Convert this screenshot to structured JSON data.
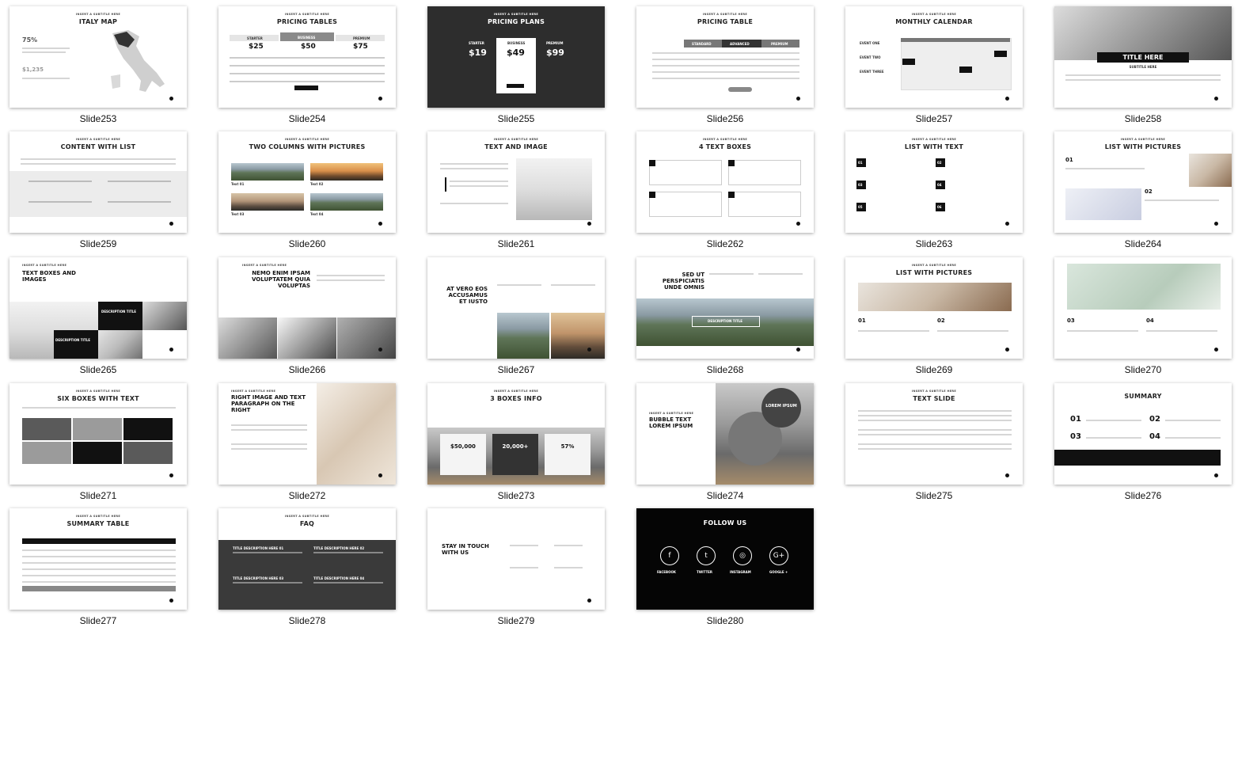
{
  "slides": [
    {
      "caption": "Slide253",
      "kicker": "INSERT A SUBTITLE HERE",
      "title": "ITALY MAP",
      "extra": [
        "75%",
        "$1,235"
      ]
    },
    {
      "caption": "Slide254",
      "kicker": "INSERT A SUBTITLE HERE",
      "title": "PRICING TABLES",
      "extra": [
        "STARTER",
        "BUSINESS",
        "PREMIUM",
        "$25",
        "$50",
        "$75"
      ]
    },
    {
      "caption": "Slide255",
      "kicker": "INSERT A SUBTITLE HERE",
      "title": "PRICING PLANS",
      "extra": [
        "STARTER",
        "BUSINESS",
        "PREMIUM",
        "$19",
        "$49",
        "$99"
      ]
    },
    {
      "caption": "Slide256",
      "kicker": "INSERT A SUBTITLE HERE",
      "title": "PRICING TABLE",
      "extra": [
        "STANDARD",
        "ADVANCED",
        "PREMIUM"
      ]
    },
    {
      "caption": "Slide257",
      "kicker": "INSERT A SUBTITLE HERE",
      "title": "MONTHLY CALENDAR",
      "extra": [
        "EVENT ONE",
        "EVENT TWO",
        "EVENT THREE"
      ]
    },
    {
      "caption": "Slide258",
      "kicker": "",
      "title": "TITLE HERE",
      "extra": [
        "SUBTITLE HERE"
      ]
    },
    {
      "caption": "Slide259",
      "kicker": "INSERT A SUBTITLE HERE",
      "title": "CONTENT WITH LIST",
      "extra": []
    },
    {
      "caption": "Slide260",
      "kicker": "INSERT A SUBTITLE HERE",
      "title": "TWO COLUMNS WITH PICTURES",
      "extra": [
        "Text 01",
        "Text 02",
        "Text 03",
        "Text 04"
      ]
    },
    {
      "caption": "Slide261",
      "kicker": "INSERT A SUBTITLE HERE",
      "title": "TEXT AND IMAGE",
      "extra": []
    },
    {
      "caption": "Slide262",
      "kicker": "INSERT A SUBTITLE HERE",
      "title": "4 TEXT BOXES",
      "extra": []
    },
    {
      "caption": "Slide263",
      "kicker": "INSERT A SUBTITLE HERE",
      "title": "LIST WITH TEXT",
      "extra": [
        "01",
        "02",
        "03",
        "04",
        "05",
        "06"
      ]
    },
    {
      "caption": "Slide264",
      "kicker": "INSERT A SUBTITLE HERE",
      "title": "LIST WITH PICTURES",
      "extra": [
        "01",
        "02"
      ]
    },
    {
      "caption": "Slide265",
      "kicker": "INSERT A SUBTITLE HERE",
      "title": "TEXT BOXES AND IMAGES",
      "extra": [
        "DESCRIPTION TITLE",
        "DESCRIPTION TITLE"
      ]
    },
    {
      "caption": "Slide266",
      "kicker": "INSERT A SUBTITLE HERE",
      "title": "NEMO ENIM IPSAM VOLUPTATEM QUIA VOLUPTAS",
      "extra": []
    },
    {
      "caption": "Slide267",
      "kicker": "",
      "title": "AT VERO EOS ACCUSAMUS ET IUSTO",
      "extra": []
    },
    {
      "caption": "Slide268",
      "kicker": "",
      "title": "SED UT PERSPICIATIS UNDE OMNIS",
      "extra": [
        "DESCRIPTION TITLE"
      ]
    },
    {
      "caption": "Slide269",
      "kicker": "INSERT A SUBTITLE HERE",
      "title": "LIST WITH PICTURES",
      "extra": [
        "01",
        "02"
      ]
    },
    {
      "caption": "Slide270",
      "kicker": "",
      "title": "",
      "extra": [
        "03",
        "04"
      ]
    },
    {
      "caption": "Slide271",
      "kicker": "INSERT A SUBTITLE HERE",
      "title": "SIX BOXES WITH TEXT",
      "extra": []
    },
    {
      "caption": "Slide272",
      "kicker": "INSERT A SUBTITLE HERE",
      "title": "RIGHT IMAGE AND TEXT PARAGRAPH ON THE RIGHT",
      "extra": []
    },
    {
      "caption": "Slide273",
      "kicker": "INSERT A SUBTITLE HERE",
      "title": "3 BOXES INFO",
      "extra": [
        "$50,000",
        "20,000+",
        "57%"
      ]
    },
    {
      "caption": "Slide274",
      "kicker": "INSERT A SUBTITLE HERE",
      "title": "BUBBLE TEXT LOREM IPSUM",
      "extra": [
        "LOREM IPSUM"
      ]
    },
    {
      "caption": "Slide275",
      "kicker": "INSERT A SUBTITLE HERE",
      "title": "TEXT SLIDE",
      "extra": []
    },
    {
      "caption": "Slide276",
      "kicker": "",
      "title": "SUMMARY",
      "extra": [
        "01",
        "02",
        "03",
        "04"
      ]
    },
    {
      "caption": "Slide277",
      "kicker": "INSERT A SUBTITLE HERE",
      "title": "SUMMARY TABLE",
      "extra": []
    },
    {
      "caption": "Slide278",
      "kicker": "INSERT A SUBTITLE HERE",
      "title": "FAQ",
      "extra": [
        "TITLE DESCRIPTION HERE 01",
        "TITLE DESCRIPTION HERE 02",
        "TITLE DESCRIPTION HERE 03",
        "TITLE DESCRIPTION HERE 04"
      ]
    },
    {
      "caption": "Slide279",
      "kicker": "",
      "title": "STAY IN TOUCH WITH US",
      "extra": []
    },
    {
      "caption": "Slide280",
      "kicker": "",
      "title": "FOLLOW US",
      "extra": [
        "FACEBOOK",
        "TWITTER",
        "INSTAGRAM",
        "GOOGLE +"
      ]
    }
  ]
}
